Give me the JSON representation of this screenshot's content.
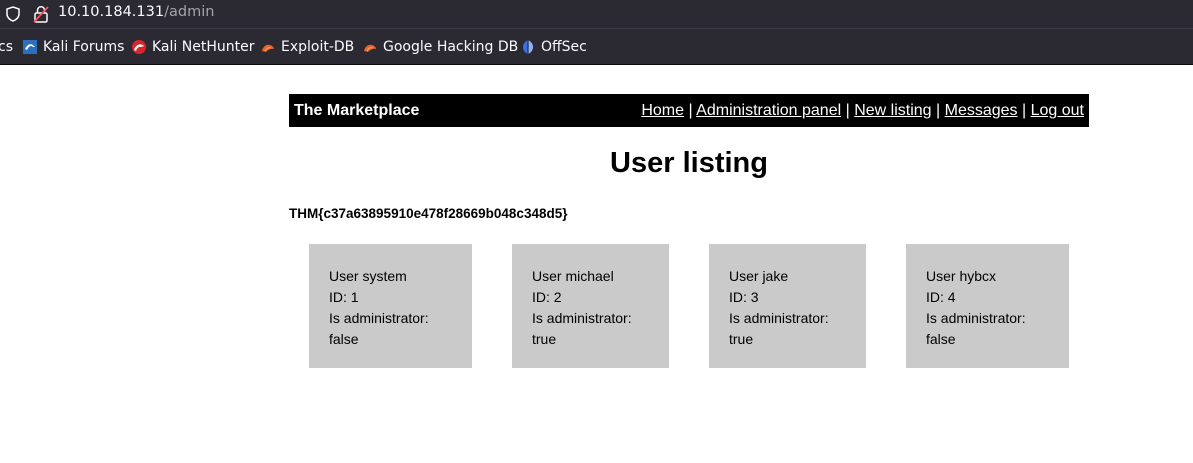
{
  "browser": {
    "url_host": "10.10.184.131",
    "url_path": "/admin",
    "bookmarks": [
      {
        "label": "cs",
        "icon": "bookmark-fragment"
      },
      {
        "label": "Kali Forums",
        "icon": "kali-forums-icon"
      },
      {
        "label": "Kali NetHunter",
        "icon": "kali-nethunter-icon"
      },
      {
        "label": "Exploit-DB",
        "icon": "exploit-db-icon"
      },
      {
        "label": "Google Hacking DB",
        "icon": "google-hacking-db-icon"
      },
      {
        "label": "OffSec",
        "icon": "offsec-icon"
      }
    ]
  },
  "header": {
    "title": "The Marketplace",
    "nav": [
      {
        "label": "Home"
      },
      {
        "label": "Administration panel"
      },
      {
        "label": "New listing"
      },
      {
        "label": "Messages"
      },
      {
        "label": "Log out"
      }
    ],
    "separator": "|"
  },
  "main": {
    "heading": "User listing",
    "flag": "THM{c37a63895910e478f28669b048c348d5}",
    "users": [
      {
        "name": "User system",
        "id": "ID: 1",
        "admin_label": "Is administrator:",
        "admin_value": "false"
      },
      {
        "name": "User michael",
        "id": "ID: 2",
        "admin_label": "Is administrator:",
        "admin_value": "true"
      },
      {
        "name": "User jake",
        "id": "ID: 3",
        "admin_label": "Is administrator:",
        "admin_value": "true"
      },
      {
        "name": "User hybcx",
        "id": "ID: 4",
        "admin_label": "Is administrator:",
        "admin_value": "false"
      }
    ]
  },
  "colors": {
    "chrome_bg": "#2b2a33",
    "header_bg": "#000000",
    "card_bg": "#cacaca"
  }
}
